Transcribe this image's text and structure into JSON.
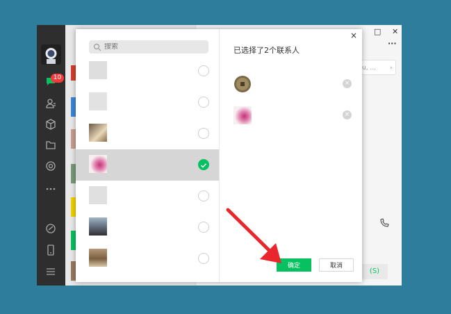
{
  "sidebar": {
    "badge": "10",
    "icons": [
      "chat-icon",
      "contacts-icon",
      "cube-icon",
      "folder-icon",
      "gear-icon",
      "more-icon",
      "link-icon",
      "phone-icon",
      "menu-icon"
    ]
  },
  "window_controls": {
    "minimize": "—",
    "maximize": "□",
    "close": "✕",
    "more": "···"
  },
  "chat_main": {
    "search_hint": "u, ...",
    "call_label": "(S)"
  },
  "dialog": {
    "search_placeholder": "搜索",
    "title": "已选择了2个联系人",
    "close": "×",
    "confirm_label": "确定",
    "cancel_label": "取消",
    "contacts": [
      {
        "checked": false
      },
      {
        "checked": false
      },
      {
        "checked": false
      },
      {
        "checked": true
      },
      {
        "checked": false
      },
      {
        "checked": false
      },
      {
        "checked": false
      }
    ],
    "selected": [
      {
        "remove": "×"
      },
      {
        "remove": "×"
      }
    ]
  },
  "colors": {
    "accent": "#07c160",
    "badge": "#f23c3c",
    "background": "#2f7d9c",
    "arrow": "#e8262b"
  }
}
